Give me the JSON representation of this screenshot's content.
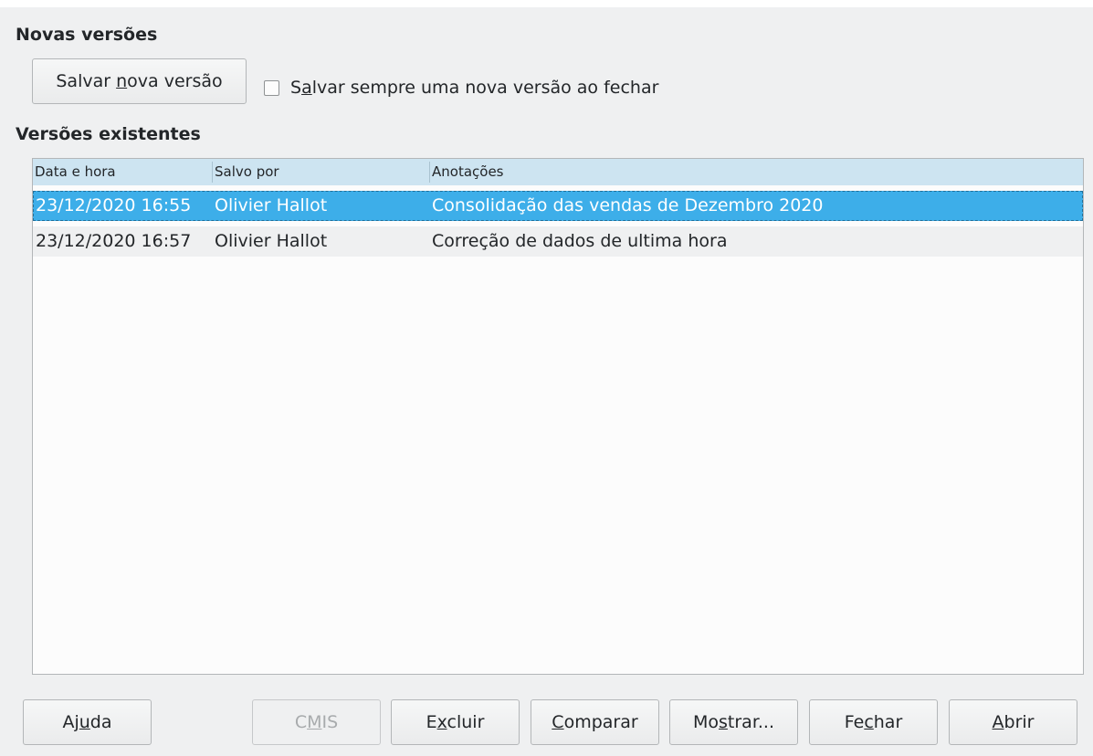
{
  "new_versions": {
    "title": "Novas versões",
    "save_button": "Salvar nova versão",
    "save_button_prefix": "Salvar ",
    "save_button_mnemonic": "n",
    "save_button_suffix": "ova versão",
    "always_save_checkbox": {
      "prefix": "S",
      "mnemonic": "a",
      "suffix": "lvar sempre uma nova versão ao fechar",
      "checked": false
    }
  },
  "existing_versions": {
    "title": "Versões existentes",
    "columns": [
      "Data e hora",
      "Salvo por",
      "Anotações"
    ],
    "rows": [
      {
        "datetime": "23/12/2020 16:55",
        "saved_by": "Olivier Hallot",
        "notes": "Consolidação das vendas de Dezembro 2020",
        "selected": true
      },
      {
        "datetime": "23/12/2020 16:57",
        "saved_by": "Olivier Hallot",
        "notes": "Correção de dados de ultima hora",
        "selected": false
      }
    ]
  },
  "buttons": {
    "help": {
      "prefix": "Aj",
      "mnemonic": "u",
      "suffix": "da"
    },
    "cmis": {
      "prefix": "C",
      "mnemonic": "M",
      "suffix": "IS",
      "enabled": false
    },
    "delete": {
      "prefix": "E",
      "mnemonic": "x",
      "suffix": "cluir"
    },
    "compare": {
      "prefix": "",
      "mnemonic": "C",
      "suffix": "omparar"
    },
    "show": {
      "prefix": "Mo",
      "mnemonic": "s",
      "suffix": "trar..."
    },
    "close": {
      "prefix": "Fe",
      "mnemonic": "c",
      "suffix": "har"
    },
    "open": {
      "prefix": "",
      "mnemonic": "A",
      "suffix": "brir"
    }
  },
  "colors": {
    "selection": "#3daee9",
    "header": "#cde4f1",
    "background": "#eff0f1"
  }
}
